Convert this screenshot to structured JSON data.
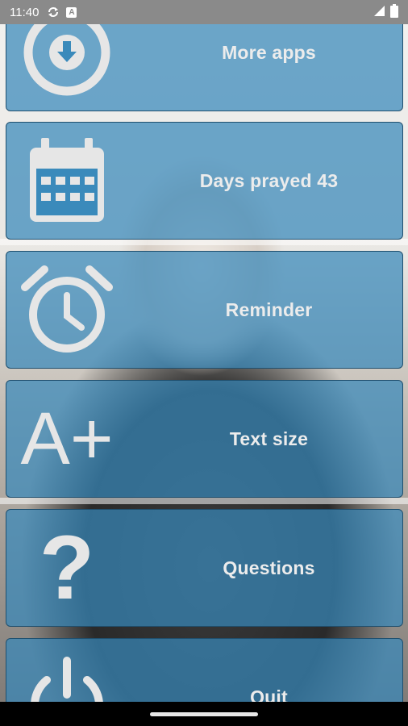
{
  "status_bar": {
    "time": "11:40",
    "icons": [
      "sync-icon",
      "a-notification-icon",
      "signal-icon",
      "battery-icon"
    ],
    "notification_letter": "A"
  },
  "menu": {
    "items": [
      {
        "label": "More apps",
        "icon": "download-circle-icon"
      },
      {
        "label": "Days prayed 43",
        "icon": "calendar-icon"
      },
      {
        "label": "Reminder",
        "icon": "alarm-clock-icon"
      },
      {
        "label": "Text size",
        "icon": "text-size-icon",
        "icon_text": "A+"
      },
      {
        "label": "Questions",
        "icon": "question-icon",
        "icon_text": "?"
      },
      {
        "label": "Quit",
        "icon": "power-icon"
      }
    ]
  },
  "colors": {
    "card": "#3888ba",
    "card_border": "#1f4f6e",
    "icon": "#e6e6e6",
    "status_bar": "#8a8a8a"
  }
}
